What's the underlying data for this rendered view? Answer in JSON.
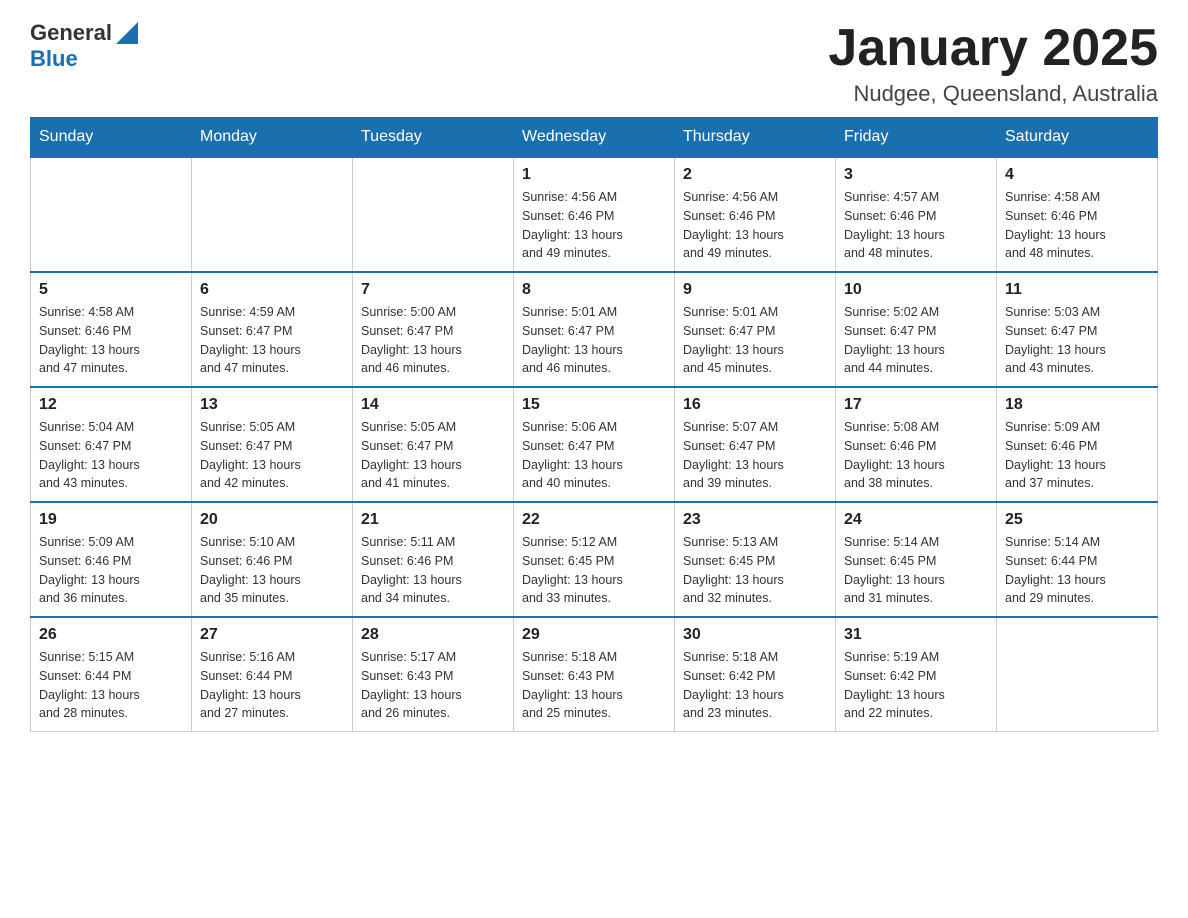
{
  "header": {
    "logo": {
      "general": "General",
      "blue": "Blue"
    },
    "title": "January 2025",
    "location": "Nudgee, Queensland, Australia"
  },
  "calendar": {
    "days_of_week": [
      "Sunday",
      "Monday",
      "Tuesday",
      "Wednesday",
      "Thursday",
      "Friday",
      "Saturday"
    ],
    "weeks": [
      [
        {
          "day": "",
          "info": ""
        },
        {
          "day": "",
          "info": ""
        },
        {
          "day": "",
          "info": ""
        },
        {
          "day": "1",
          "info": "Sunrise: 4:56 AM\nSunset: 6:46 PM\nDaylight: 13 hours\nand 49 minutes."
        },
        {
          "day": "2",
          "info": "Sunrise: 4:56 AM\nSunset: 6:46 PM\nDaylight: 13 hours\nand 49 minutes."
        },
        {
          "day": "3",
          "info": "Sunrise: 4:57 AM\nSunset: 6:46 PM\nDaylight: 13 hours\nand 48 minutes."
        },
        {
          "day": "4",
          "info": "Sunrise: 4:58 AM\nSunset: 6:46 PM\nDaylight: 13 hours\nand 48 minutes."
        }
      ],
      [
        {
          "day": "5",
          "info": "Sunrise: 4:58 AM\nSunset: 6:46 PM\nDaylight: 13 hours\nand 47 minutes."
        },
        {
          "day": "6",
          "info": "Sunrise: 4:59 AM\nSunset: 6:47 PM\nDaylight: 13 hours\nand 47 minutes."
        },
        {
          "day": "7",
          "info": "Sunrise: 5:00 AM\nSunset: 6:47 PM\nDaylight: 13 hours\nand 46 minutes."
        },
        {
          "day": "8",
          "info": "Sunrise: 5:01 AM\nSunset: 6:47 PM\nDaylight: 13 hours\nand 46 minutes."
        },
        {
          "day": "9",
          "info": "Sunrise: 5:01 AM\nSunset: 6:47 PM\nDaylight: 13 hours\nand 45 minutes."
        },
        {
          "day": "10",
          "info": "Sunrise: 5:02 AM\nSunset: 6:47 PM\nDaylight: 13 hours\nand 44 minutes."
        },
        {
          "day": "11",
          "info": "Sunrise: 5:03 AM\nSunset: 6:47 PM\nDaylight: 13 hours\nand 43 minutes."
        }
      ],
      [
        {
          "day": "12",
          "info": "Sunrise: 5:04 AM\nSunset: 6:47 PM\nDaylight: 13 hours\nand 43 minutes."
        },
        {
          "day": "13",
          "info": "Sunrise: 5:05 AM\nSunset: 6:47 PM\nDaylight: 13 hours\nand 42 minutes."
        },
        {
          "day": "14",
          "info": "Sunrise: 5:05 AM\nSunset: 6:47 PM\nDaylight: 13 hours\nand 41 minutes."
        },
        {
          "day": "15",
          "info": "Sunrise: 5:06 AM\nSunset: 6:47 PM\nDaylight: 13 hours\nand 40 minutes."
        },
        {
          "day": "16",
          "info": "Sunrise: 5:07 AM\nSunset: 6:47 PM\nDaylight: 13 hours\nand 39 minutes."
        },
        {
          "day": "17",
          "info": "Sunrise: 5:08 AM\nSunset: 6:46 PM\nDaylight: 13 hours\nand 38 minutes."
        },
        {
          "day": "18",
          "info": "Sunrise: 5:09 AM\nSunset: 6:46 PM\nDaylight: 13 hours\nand 37 minutes."
        }
      ],
      [
        {
          "day": "19",
          "info": "Sunrise: 5:09 AM\nSunset: 6:46 PM\nDaylight: 13 hours\nand 36 minutes."
        },
        {
          "day": "20",
          "info": "Sunrise: 5:10 AM\nSunset: 6:46 PM\nDaylight: 13 hours\nand 35 minutes."
        },
        {
          "day": "21",
          "info": "Sunrise: 5:11 AM\nSunset: 6:46 PM\nDaylight: 13 hours\nand 34 minutes."
        },
        {
          "day": "22",
          "info": "Sunrise: 5:12 AM\nSunset: 6:45 PM\nDaylight: 13 hours\nand 33 minutes."
        },
        {
          "day": "23",
          "info": "Sunrise: 5:13 AM\nSunset: 6:45 PM\nDaylight: 13 hours\nand 32 minutes."
        },
        {
          "day": "24",
          "info": "Sunrise: 5:14 AM\nSunset: 6:45 PM\nDaylight: 13 hours\nand 31 minutes."
        },
        {
          "day": "25",
          "info": "Sunrise: 5:14 AM\nSunset: 6:44 PM\nDaylight: 13 hours\nand 29 minutes."
        }
      ],
      [
        {
          "day": "26",
          "info": "Sunrise: 5:15 AM\nSunset: 6:44 PM\nDaylight: 13 hours\nand 28 minutes."
        },
        {
          "day": "27",
          "info": "Sunrise: 5:16 AM\nSunset: 6:44 PM\nDaylight: 13 hours\nand 27 minutes."
        },
        {
          "day": "28",
          "info": "Sunrise: 5:17 AM\nSunset: 6:43 PM\nDaylight: 13 hours\nand 26 minutes."
        },
        {
          "day": "29",
          "info": "Sunrise: 5:18 AM\nSunset: 6:43 PM\nDaylight: 13 hours\nand 25 minutes."
        },
        {
          "day": "30",
          "info": "Sunrise: 5:18 AM\nSunset: 6:42 PM\nDaylight: 13 hours\nand 23 minutes."
        },
        {
          "day": "31",
          "info": "Sunrise: 5:19 AM\nSunset: 6:42 PM\nDaylight: 13 hours\nand 22 minutes."
        },
        {
          "day": "",
          "info": ""
        }
      ]
    ]
  }
}
